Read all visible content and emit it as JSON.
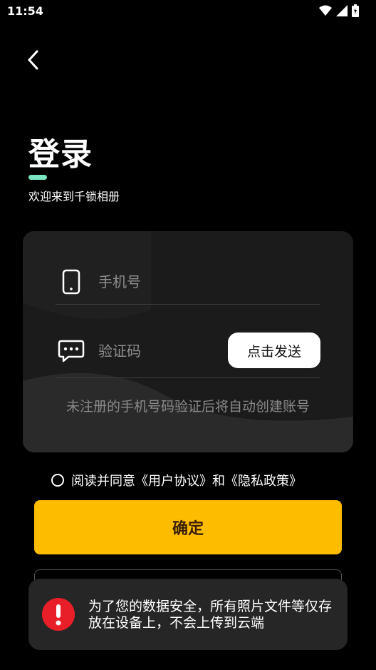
{
  "status_bar": {
    "time": "11:54",
    "icons": [
      "wifi-icon",
      "signal-icon",
      "battery-icon"
    ]
  },
  "header": {
    "back_icon": "chevron-left-icon",
    "title": "登录",
    "subtitle": "欢迎来到千锁相册",
    "accent_color": "#7ce5c3"
  },
  "form": {
    "phone": {
      "icon": "phone-icon",
      "placeholder": "手机号",
      "value": ""
    },
    "code": {
      "icon": "chat-bubble-icon",
      "placeholder": "验证码",
      "value": ""
    },
    "send_button": "点击发送",
    "hint": "未注册的手机号码验证后将自动创建账号"
  },
  "agreement": {
    "checked": false,
    "text": "阅读并同意《用户协议》和《隐私政策》"
  },
  "confirm_button": {
    "label": "确定",
    "color": "#fdbc00"
  },
  "toast": {
    "icon": "alert-icon",
    "text": "为了您的数据安全，所有照片文件等仅存放在设备上，不会上传到云端",
    "color": "#e81f28"
  }
}
